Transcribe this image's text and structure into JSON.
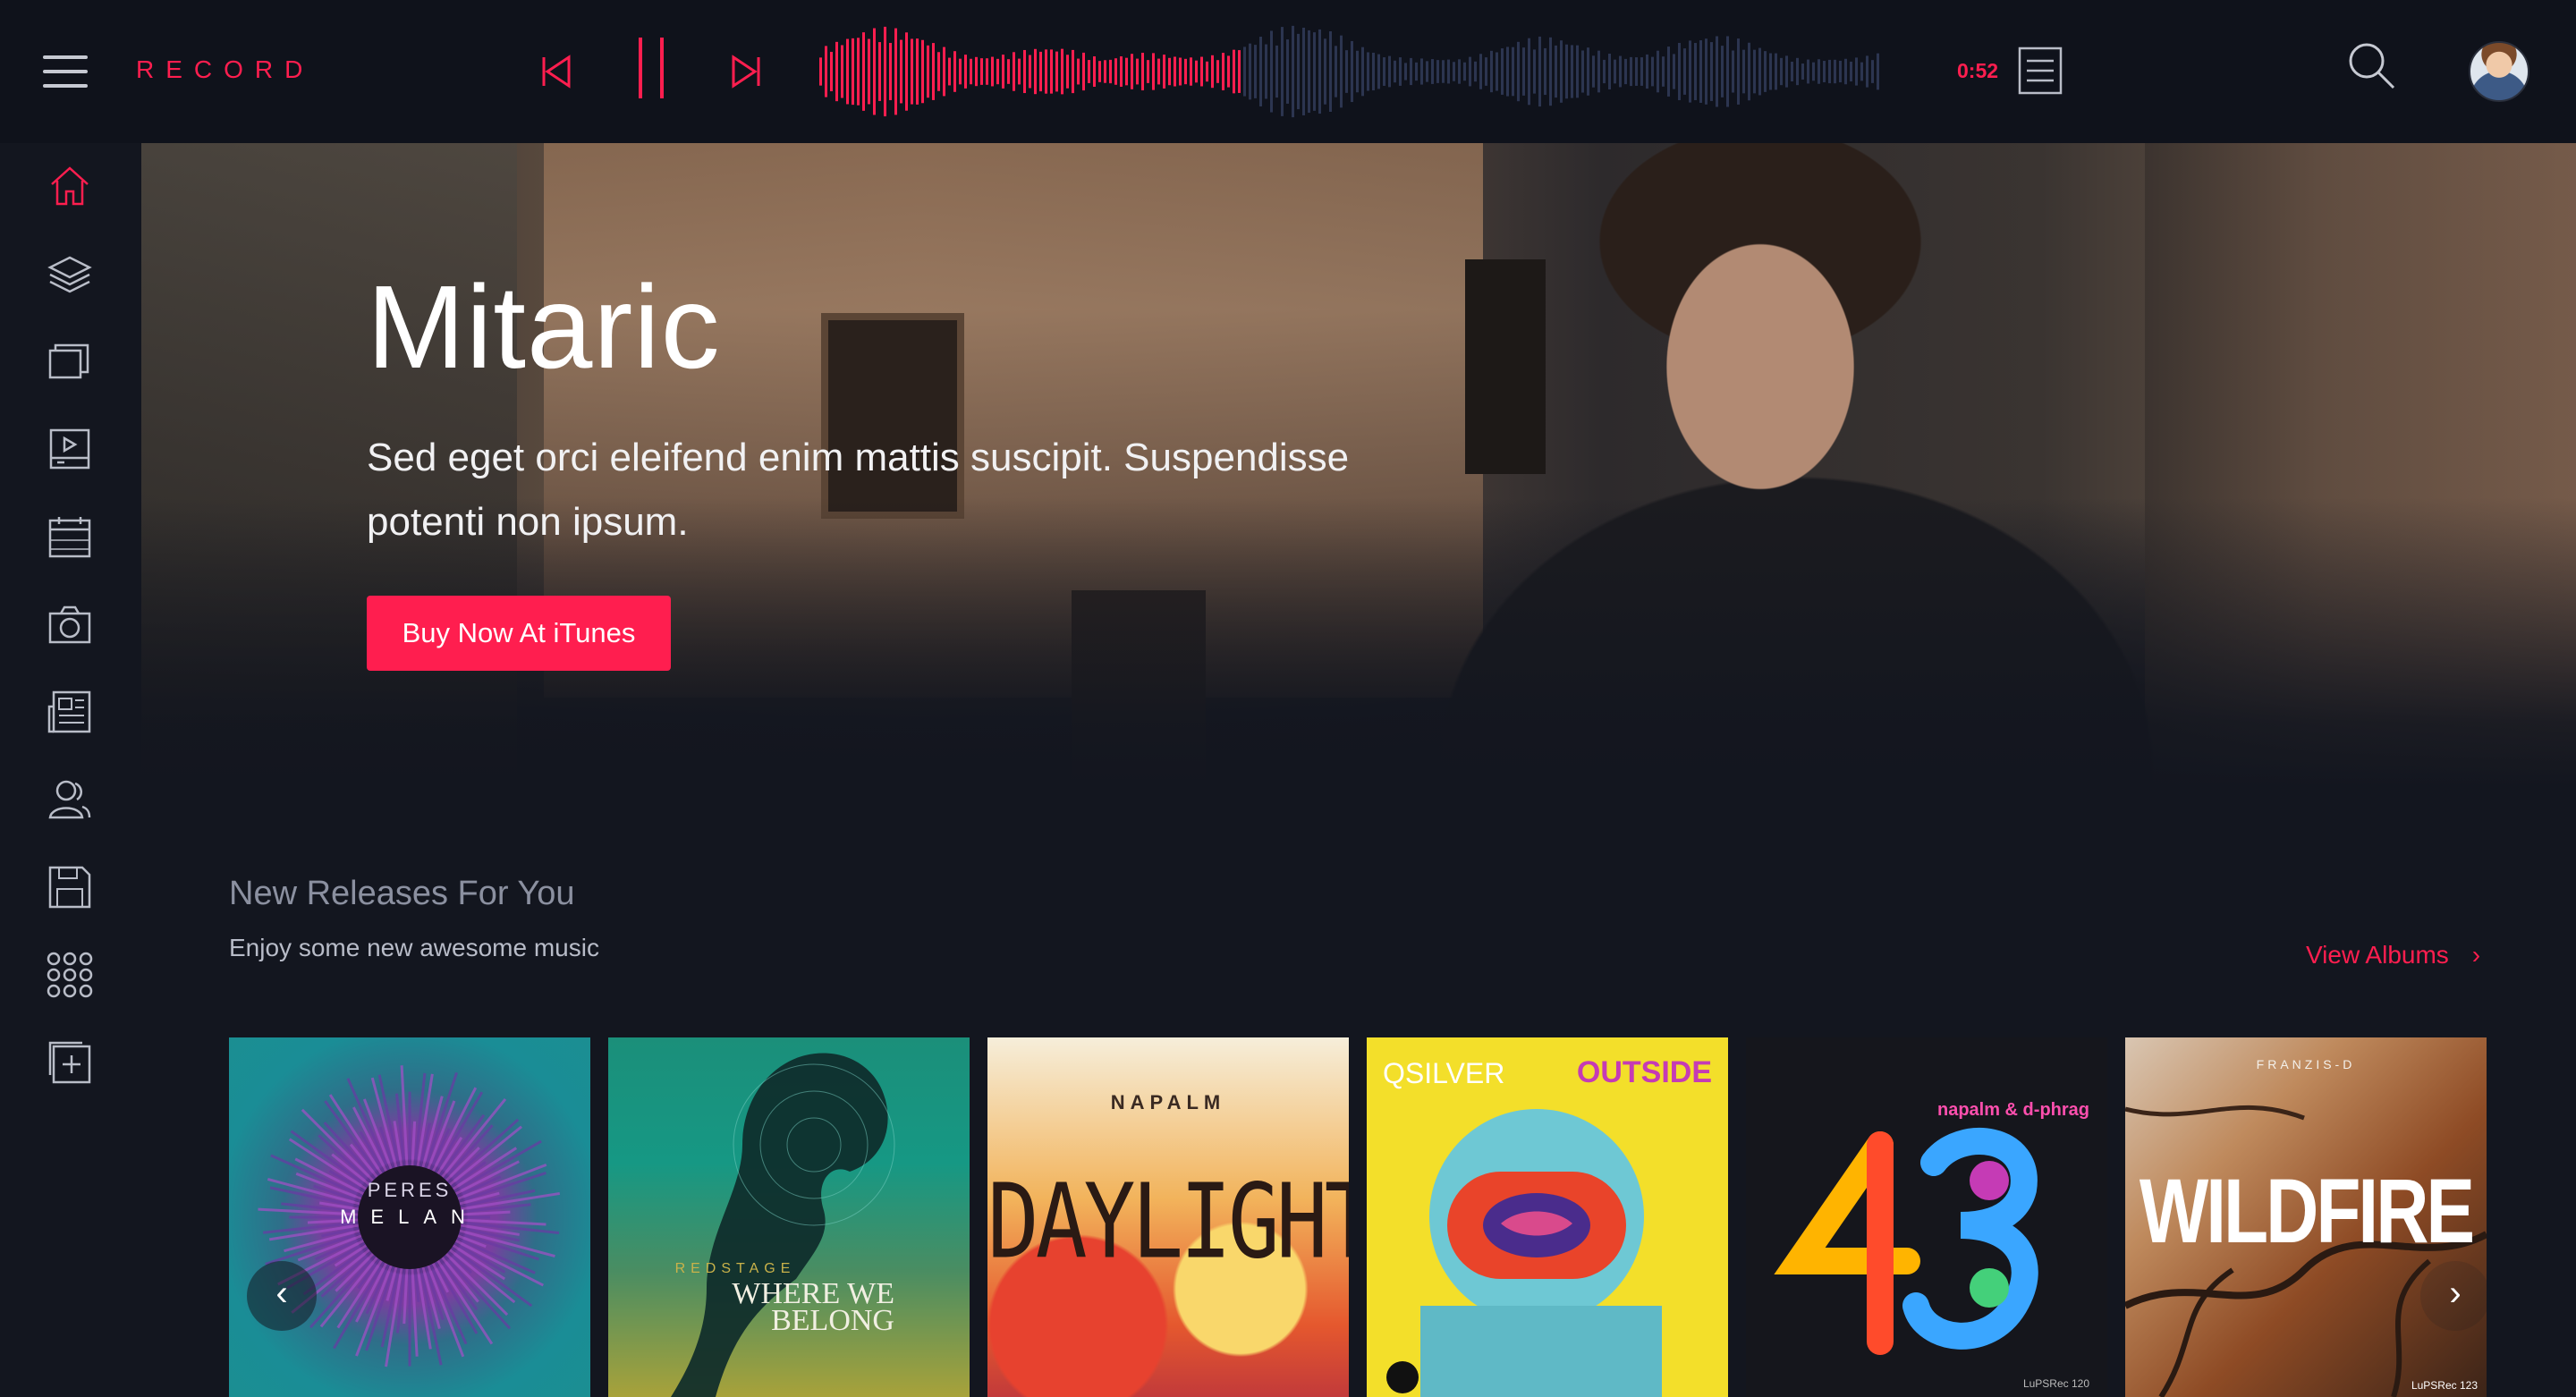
{
  "app": {
    "brand": "RECORD"
  },
  "player": {
    "time": "0:52",
    "progress": 0.4,
    "accent": "#ff1e4f",
    "wave_inactive": "#2c3550"
  },
  "header_icons": {
    "menu": "hamburger-icon",
    "prev": "skip-previous-icon",
    "pause": "pause-icon",
    "next": "skip-next-icon",
    "queue": "playlist-icon",
    "search": "search-icon"
  },
  "sidebar": {
    "items": [
      {
        "icon": "home-icon",
        "active": true
      },
      {
        "icon": "layers-icon"
      },
      {
        "icon": "albums-icon"
      },
      {
        "icon": "video-icon"
      },
      {
        "icon": "calendar-icon"
      },
      {
        "icon": "camera-icon"
      },
      {
        "icon": "news-icon"
      },
      {
        "icon": "artists-icon"
      },
      {
        "icon": "save-icon"
      },
      {
        "icon": "apps-grid-icon"
      },
      {
        "icon": "add-playlist-icon"
      }
    ]
  },
  "hero": {
    "title": "Mitaric",
    "subtitle": "Sed eget orci eleifend enim mattis suscipit. Suspendisse potenti non ipsum.",
    "cta": "Buy Now At iTunes"
  },
  "releases": {
    "title": "New Releases For You",
    "subtitle": "Enjoy some new awesome music",
    "view_all": "View Albums",
    "view_all_chevron": "›",
    "prev_arrow": "‹",
    "next_arrow": "›",
    "albums": [
      {
        "artist": "PERES",
        "title": "MELAN"
      },
      {
        "artist": "REDSTAGE",
        "title": "WHERE WE BELONG"
      },
      {
        "artist": "NAPALM",
        "title": "DAYLIGHT"
      },
      {
        "artist": "QSILVER",
        "title": "OUTSIDE"
      },
      {
        "artist": "napalm & d-phrag",
        "title": "43",
        "footer": "LuPSRec 120"
      },
      {
        "artist": "FRANZIS-D",
        "title": "WILDFIRE",
        "footer": "LuPSRec 123"
      }
    ]
  }
}
